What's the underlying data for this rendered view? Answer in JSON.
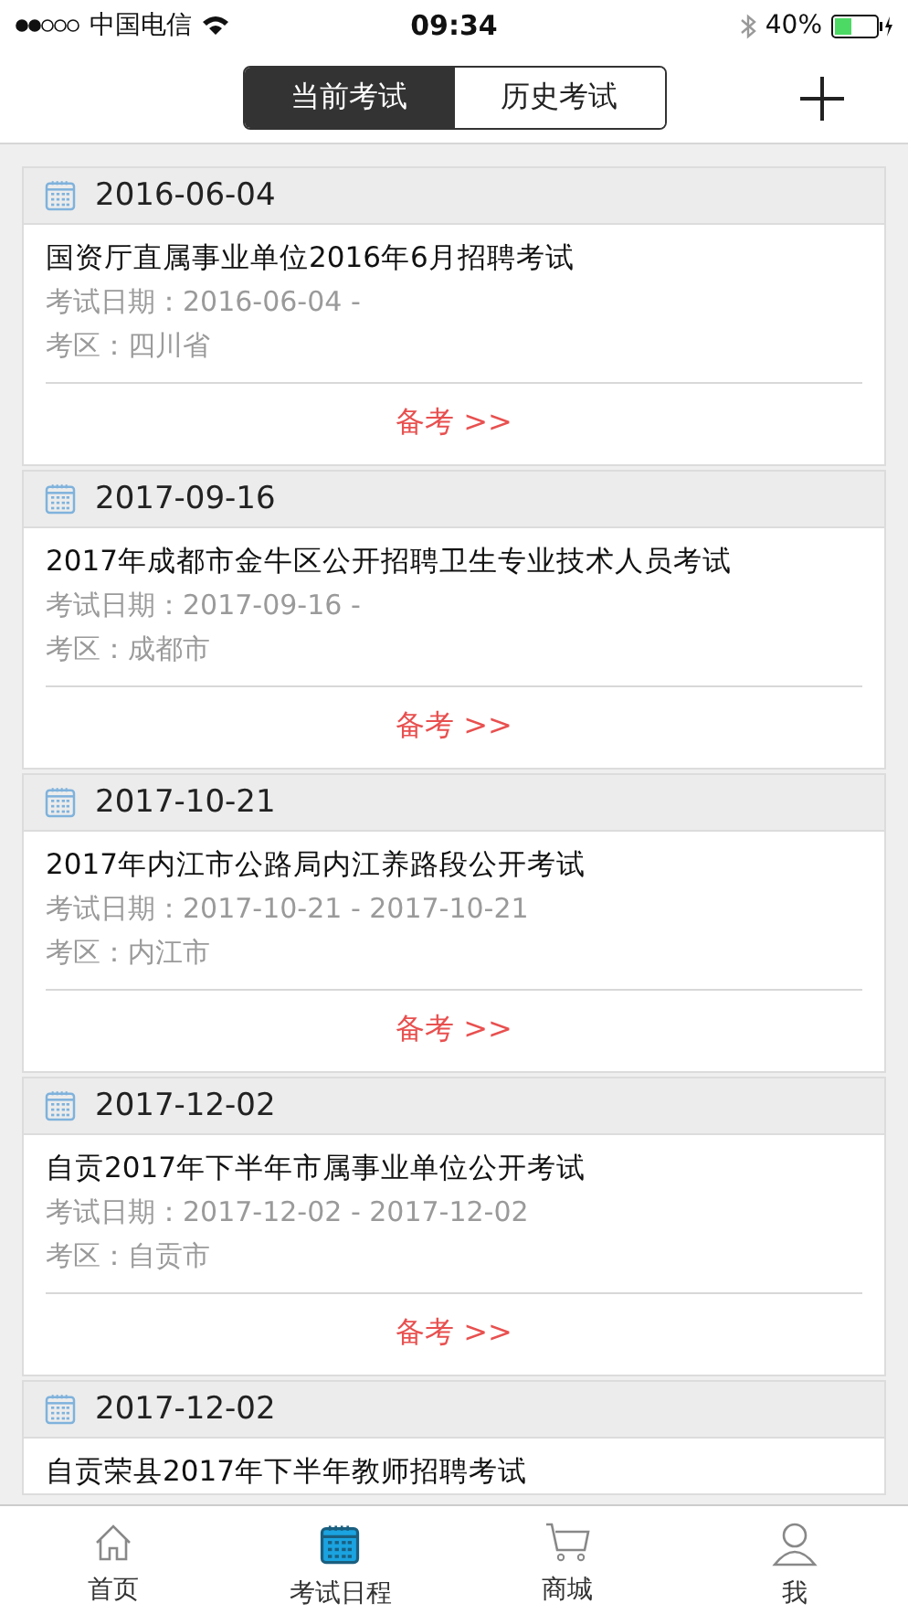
{
  "status_bar": {
    "carrier": "中国电信",
    "time": "09:34",
    "battery": "40%"
  },
  "segments": [
    {
      "label": "当前考试",
      "selected": true
    },
    {
      "label": "历史考试",
      "selected": false
    }
  ],
  "exams": [
    {
      "date": "2016-06-04",
      "title": "国资厅直属事业单位2016年6月招聘考试",
      "exam_date": "考试日期：2016-06-04 -",
      "region": "考区：四川省",
      "action": "备考 >>"
    },
    {
      "date": "2017-09-16",
      "title": "2017年成都市金牛区公开招聘卫生专业技术人员考试",
      "exam_date": "考试日期：2017-09-16 -",
      "region": "考区：成都市",
      "action": "备考 >>"
    },
    {
      "date": "2017-10-21",
      "title": "2017年内江市公路局内江养路段公开考试",
      "exam_date": "考试日期：2017-10-21 - 2017-10-21",
      "region": "考区：内江市",
      "action": "备考 >>"
    },
    {
      "date": "2017-12-02",
      "title": "自贡2017年下半年市属事业单位公开考试",
      "exam_date": "考试日期：2017-12-02 - 2017-12-02",
      "region": "考区：自贡市",
      "action": "备考 >>"
    },
    {
      "date": "2017-12-02",
      "title": "自贡荣县2017年下半年教师招聘考试"
    }
  ],
  "tab_bar": [
    {
      "label": "首页",
      "kind": "home",
      "selected": false
    },
    {
      "label": "考试日程",
      "kind": "calendar",
      "selected": true
    },
    {
      "label": "商城",
      "kind": "cart",
      "selected": false
    },
    {
      "label": "我",
      "kind": "person",
      "selected": false
    }
  ]
}
